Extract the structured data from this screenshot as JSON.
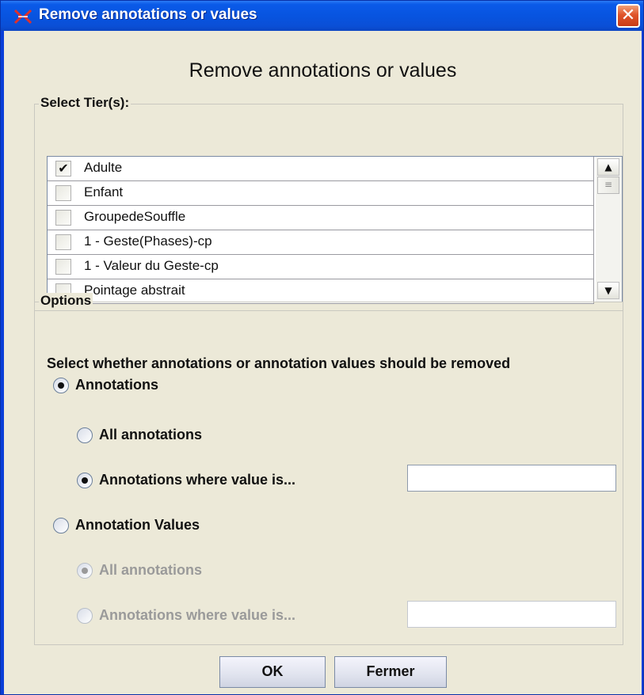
{
  "window": {
    "title": "Remove annotations or values",
    "close_label": "✕"
  },
  "dialog": {
    "heading": "Remove annotations or values"
  },
  "tiers": {
    "label": "Select Tier(s):",
    "items": [
      {
        "label": "Adulte",
        "checked": true,
        "check_glyph": "✔"
      },
      {
        "label": "Enfant",
        "checked": false,
        "check_glyph": ""
      },
      {
        "label": "GroupedeSouffle",
        "checked": false,
        "check_glyph": ""
      },
      {
        "label": "1 - Geste(Phases)-cp",
        "checked": false,
        "check_glyph": ""
      },
      {
        "label": "1 - Valeur du Geste-cp",
        "checked": false,
        "check_glyph": ""
      },
      {
        "label": "Pointage abstrait",
        "checked": false,
        "check_glyph": ""
      }
    ],
    "scroll_up_glyph": "▲",
    "scroll_down_glyph": "▼",
    "scroll_thumb_glyph": "≡"
  },
  "options": {
    "label": "Options",
    "description": "Select whether annotations or annotation values should be removed",
    "annotations": {
      "label": "Annotations",
      "selected": true,
      "all_label": "All annotations",
      "all_selected": false,
      "where_label": "Annotations where value is...",
      "where_selected": true,
      "where_value": ""
    },
    "annotation_values": {
      "label": "Annotation Values",
      "selected": false,
      "all_label": "All annotations",
      "all_selected": true,
      "where_label": "Annotations where value is...",
      "where_selected": false,
      "where_value": ""
    }
  },
  "buttons": {
    "ok_label": "OK",
    "close_label": "Fermer"
  },
  "colors": {
    "titlebar": "#0a54e0",
    "close_button": "#d9502a",
    "background": "#ece9d8"
  }
}
